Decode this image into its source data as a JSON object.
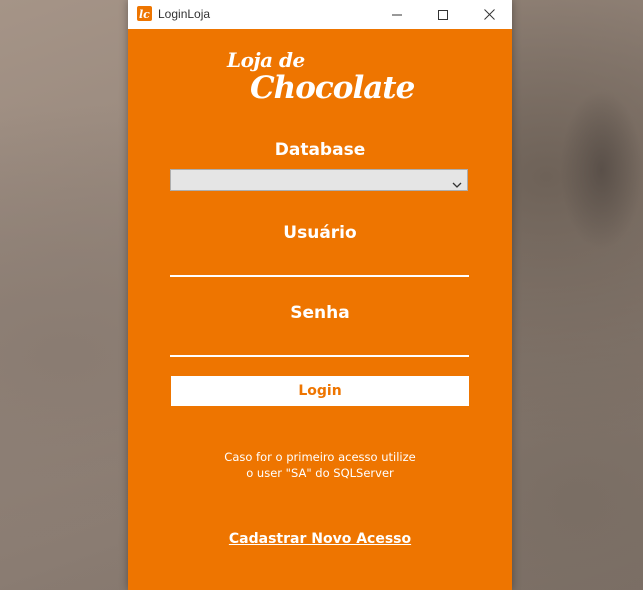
{
  "window": {
    "title": "LoginLoja",
    "icon": "app-logo-icon",
    "accent_color": "#ee7500"
  },
  "titlebar_buttons": {
    "minimize": "minimize-icon",
    "maximize": "maximize-icon",
    "close": "close-icon"
  },
  "logo": {
    "line1": "Loja de",
    "line2": "Chocolate"
  },
  "form": {
    "database_label": "Database",
    "database_selected": "",
    "user_label": "Usuário",
    "user_value": "",
    "password_label": "Senha",
    "password_value": "",
    "login_button": "Login"
  },
  "hint": {
    "line1": "Caso for o primeiro acesso utilize",
    "line2": "o user \"SA\" do SQLServer"
  },
  "register_link": "Cadastrar Novo Acesso"
}
